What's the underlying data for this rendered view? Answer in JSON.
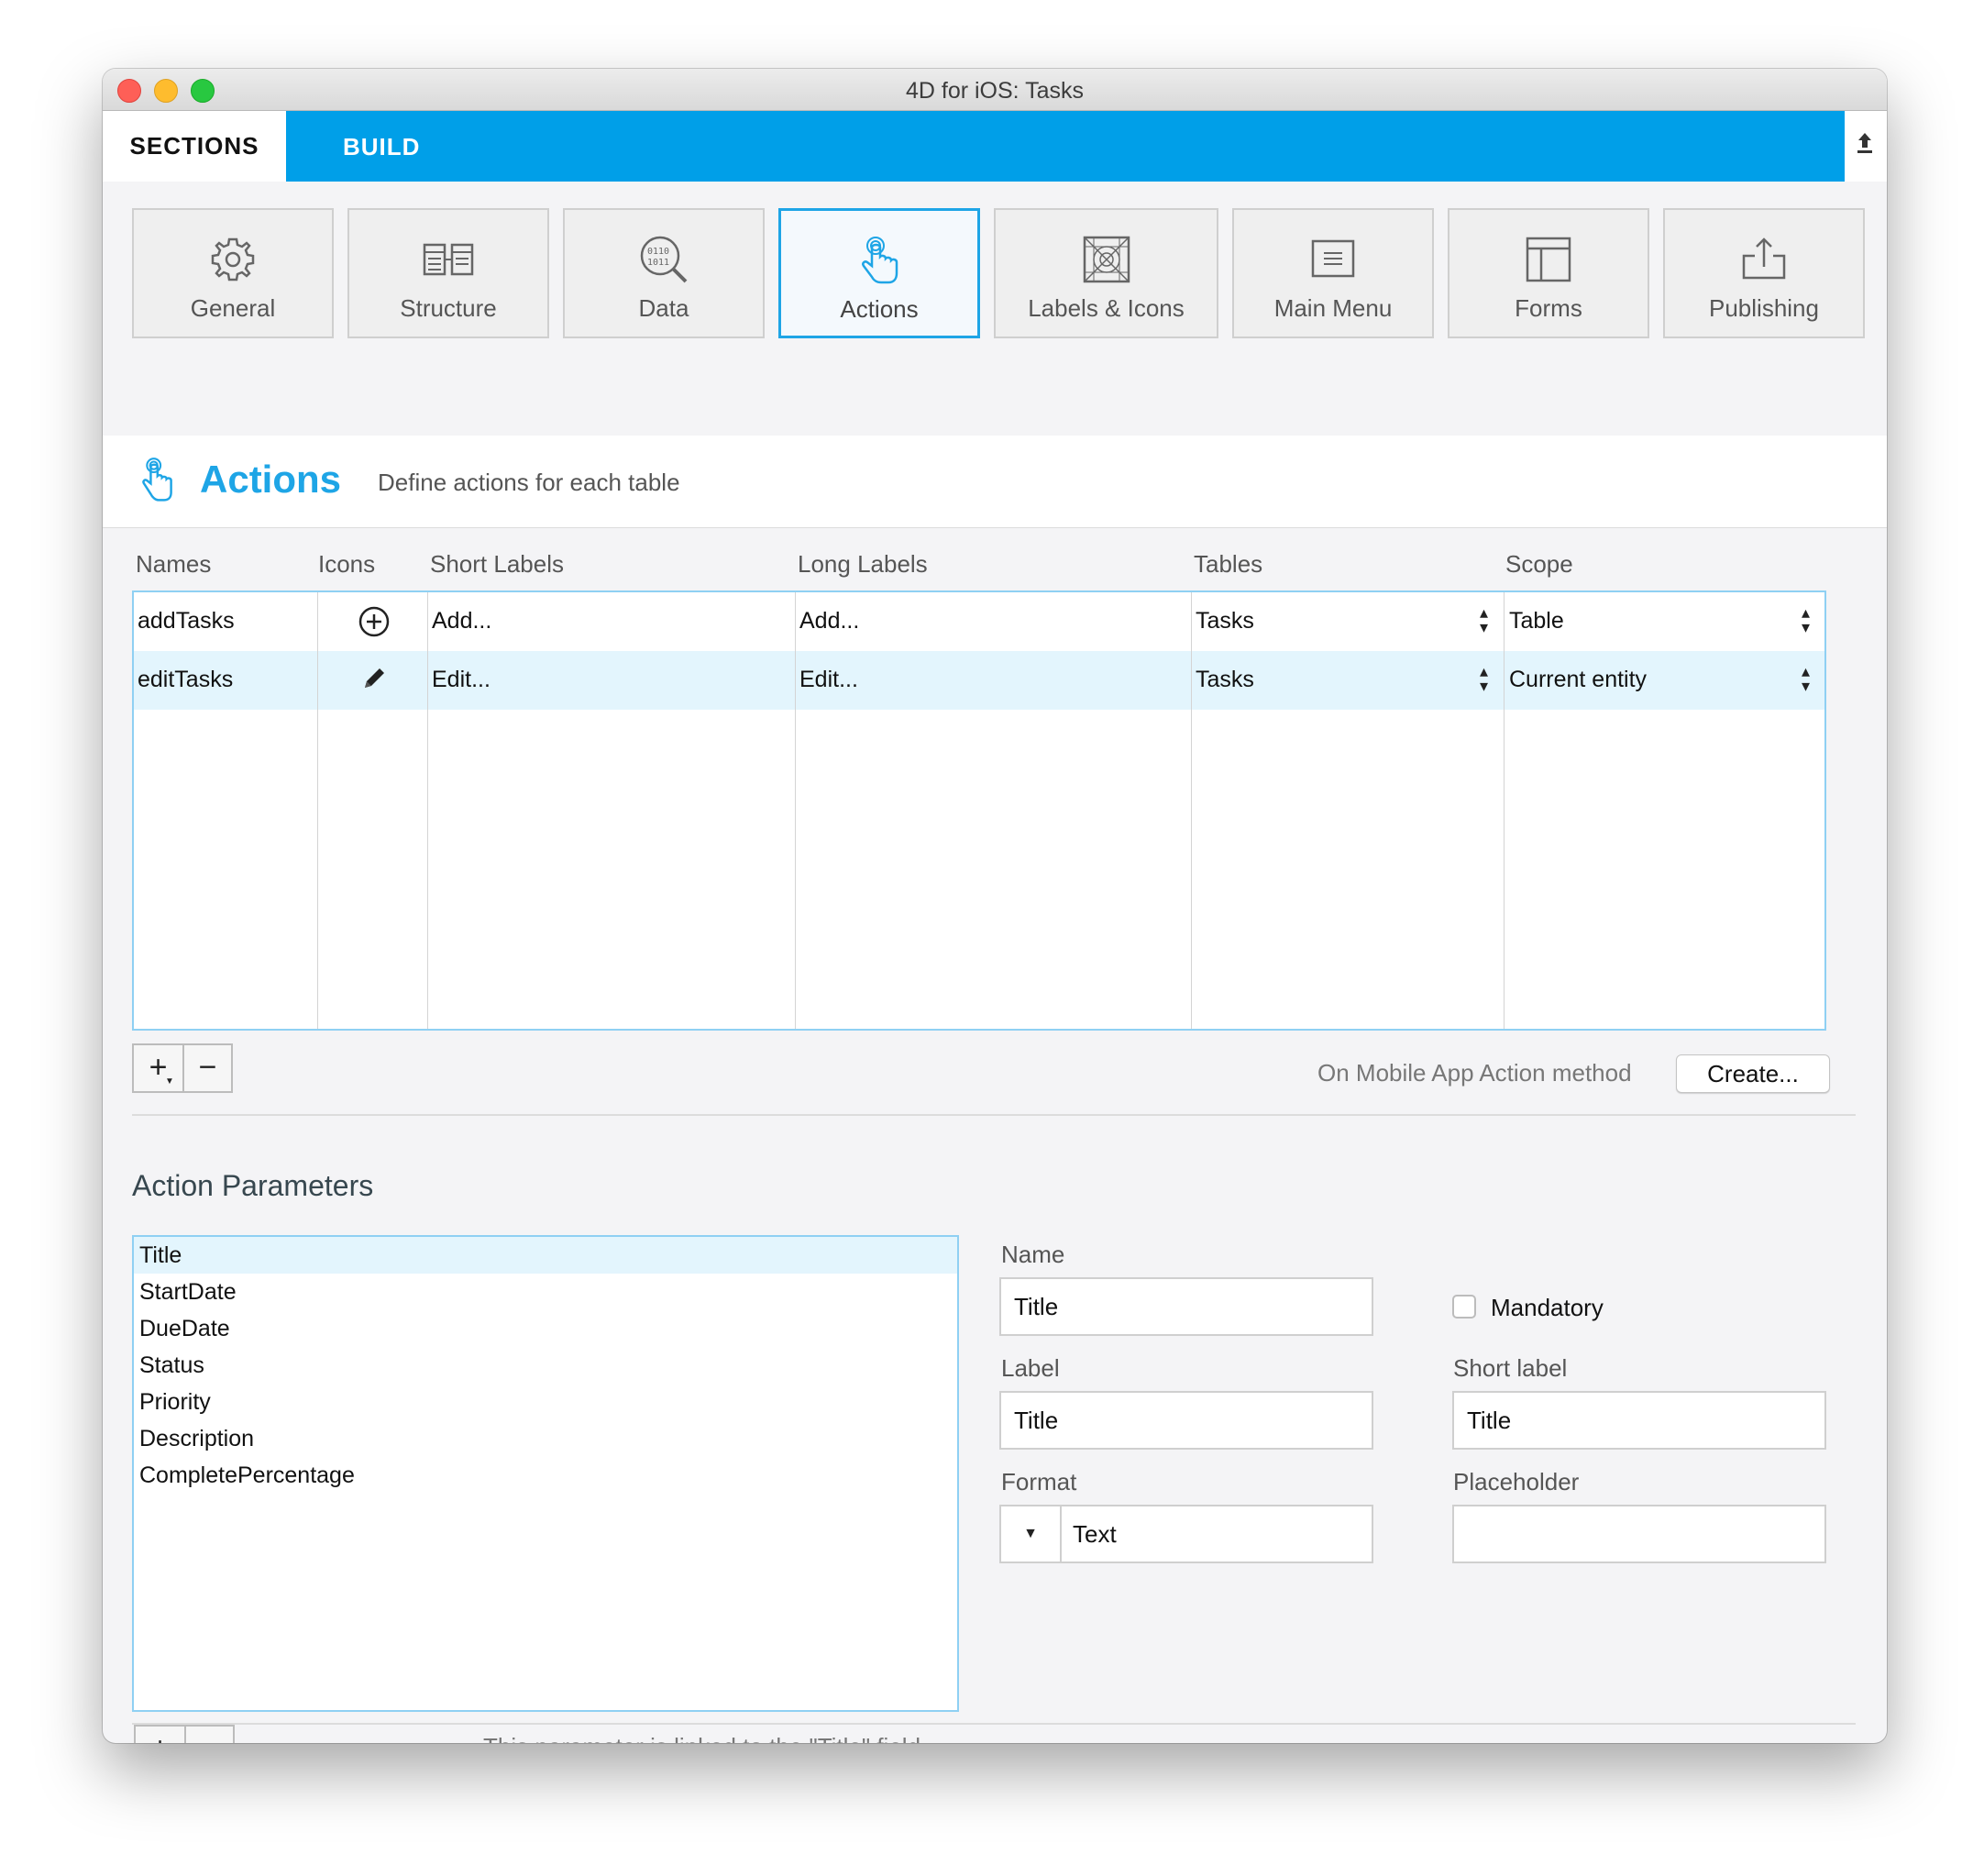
{
  "window": {
    "title": "4D for iOS: Tasks"
  },
  "top_tabs": {
    "sections": "SECTIONS",
    "build": "BUILD"
  },
  "sections": [
    {
      "label": "General",
      "icon": "gear-icon"
    },
    {
      "label": "Structure",
      "icon": "structure-icon"
    },
    {
      "label": "Data",
      "icon": "data-icon"
    },
    {
      "label": "Actions",
      "icon": "hand-pointer-icon",
      "active": true
    },
    {
      "label": "Labels & Icons",
      "icon": "labels-icons-icon"
    },
    {
      "label": "Main Menu",
      "icon": "main-menu-icon"
    },
    {
      "label": "Forms",
      "icon": "forms-icon"
    },
    {
      "label": "Publishing",
      "icon": "publish-icon"
    }
  ],
  "header": {
    "title": "Actions",
    "subtitle": "Define actions for each table"
  },
  "actions_table": {
    "columns": [
      "Names",
      "Icons",
      "Short Labels",
      "Long Labels",
      "Tables",
      "Scope"
    ],
    "rows": [
      {
        "name": "addTasks",
        "icon": "plus-circle-icon",
        "short_label": "Add...",
        "long_label": "Add...",
        "table": "Tasks",
        "scope": "Table"
      },
      {
        "name": "editTasks",
        "icon": "pencil-icon",
        "short_label": "Edit...",
        "long_label": "Edit...",
        "table": "Tasks",
        "scope": "Current entity"
      }
    ]
  },
  "method": {
    "label": "On Mobile App Action method",
    "button": "Create..."
  },
  "parameters": {
    "title": "Action Parameters",
    "items": [
      "Title",
      "StartDate",
      "DueDate",
      "Status",
      "Priority",
      "Description",
      "CompletePercentage"
    ],
    "selected_index": 0,
    "linked_text": "This parameter is linked to the \"Title\" field"
  },
  "detail": {
    "name_label": "Name",
    "name_value": "Title",
    "mandatory_label": "Mandatory",
    "label_label": "Label",
    "label_value": "Title",
    "short_label_label": "Short label",
    "short_label_value": "Title",
    "format_label": "Format",
    "format_value": "Text",
    "placeholder_label": "Placeholder",
    "placeholder_value": ""
  },
  "colors": {
    "accent": "#009fe8",
    "selection": "#e3f5fd"
  }
}
